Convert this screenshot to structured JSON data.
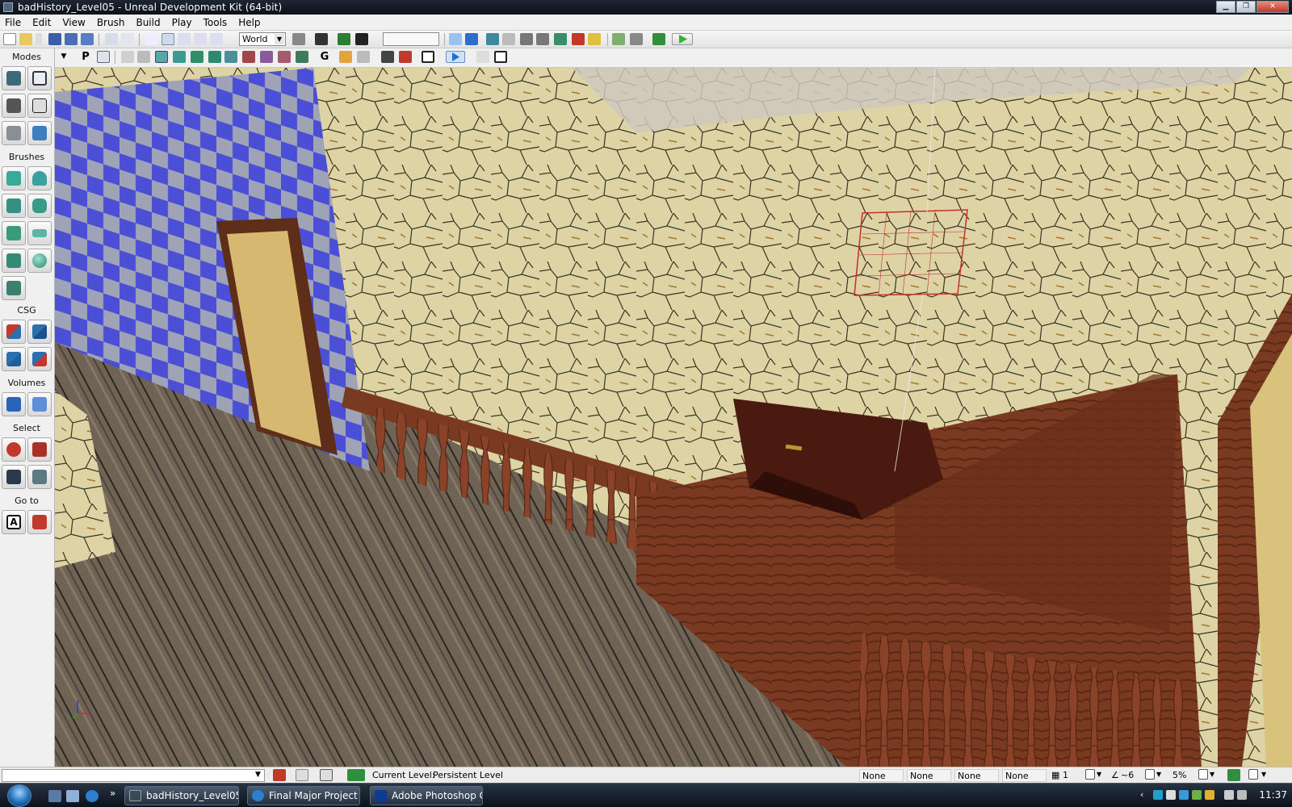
{
  "window": {
    "title": "badHistory_Level05 - Unreal Development Kit (64-bit)",
    "controls": [
      "minimize-icon",
      "maximize-icon",
      "close-icon"
    ]
  },
  "menu": [
    "File",
    "Edit",
    "View",
    "Brush",
    "Build",
    "Play",
    "Tools",
    "Help"
  ],
  "toolbar": {
    "coord_system": "World",
    "play_icon": "play-icon"
  },
  "modes_panel": {
    "sections": {
      "modes": "Modes",
      "brushes": "Brushes",
      "csg": "CSG",
      "volumes": "Volumes",
      "select": "Select",
      "goto": "Go to"
    },
    "goto_actor_label": "A"
  },
  "viewport": {
    "toolbar": {
      "perspective_label": "P",
      "game_view_label": "G"
    },
    "axis_labels": {
      "x": "x",
      "z": "z"
    }
  },
  "status_bar": {
    "current_level_label": "Current Level:",
    "current_level_value": "Persistent Level",
    "slots": [
      "None",
      "None",
      "None",
      "None"
    ],
    "grid_size": "1",
    "rotation_snap": "~6",
    "scale_snap": "5%"
  },
  "taskbar": {
    "tasks": [
      {
        "label": "badHistory_Level05 ...",
        "icon": "udk-icon",
        "color": "#3a4a5c"
      },
      {
        "label": "Final Major Project ...",
        "icon": "internet-explorer-icon",
        "color": "#2f7fd0"
      },
      {
        "label": "Adobe Photoshop C...",
        "icon": "photoshop-icon",
        "color": "#0a3d91"
      }
    ],
    "quick_launch_more": "»",
    "clock": "11:37"
  },
  "colors": {
    "checker_blue": "#4a4fd6",
    "checker_grey": "#9ea3b6",
    "wall_plaster": "#ddd3a4",
    "wood": "#7a3a22",
    "floor": "#6e6355"
  }
}
